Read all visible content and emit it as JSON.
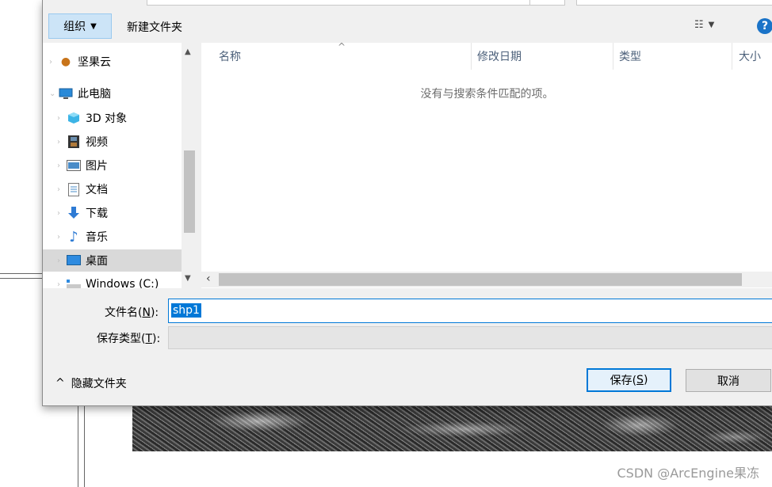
{
  "toolbar": {
    "organize_label": "组织",
    "new_folder_label": "新建文件夹"
  },
  "nav": {
    "items": [
      {
        "label": "坚果云",
        "icon": "nut-icon"
      },
      {
        "label": "此电脑",
        "icon": "computer-icon"
      },
      {
        "label": "3D 对象",
        "icon": "cube-icon"
      },
      {
        "label": "视频",
        "icon": "film-icon"
      },
      {
        "label": "图片",
        "icon": "picture-icon"
      },
      {
        "label": "文档",
        "icon": "document-icon"
      },
      {
        "label": "下载",
        "icon": "download-icon"
      },
      {
        "label": "音乐",
        "icon": "music-icon"
      },
      {
        "label": "桌面",
        "icon": "desktop-icon",
        "selected": true
      },
      {
        "label": "Windows (C:)",
        "icon": "drive-icon"
      }
    ]
  },
  "columns": {
    "name": "名称",
    "modified": "修改日期",
    "type": "类型",
    "size": "大小"
  },
  "empty_message": "没有与搜索条件匹配的项。",
  "filename": {
    "label": "文件名(",
    "accel": "N",
    "label_end": "):",
    "value": "shp1"
  },
  "filetype": {
    "label": "保存类型(",
    "accel": "T",
    "label_end": "):"
  },
  "hide_folders_label": "隐藏文件夹",
  "buttons": {
    "save_label": "保存(",
    "save_accel": "S",
    "save_end": ")",
    "cancel_label": "取消"
  },
  "watermark": "CSDN @ArcEngine果冻",
  "colors": {
    "accent": "#0078d7",
    "organize_bg": "#cce4f7",
    "selected_nav": "#d9d9d9"
  }
}
